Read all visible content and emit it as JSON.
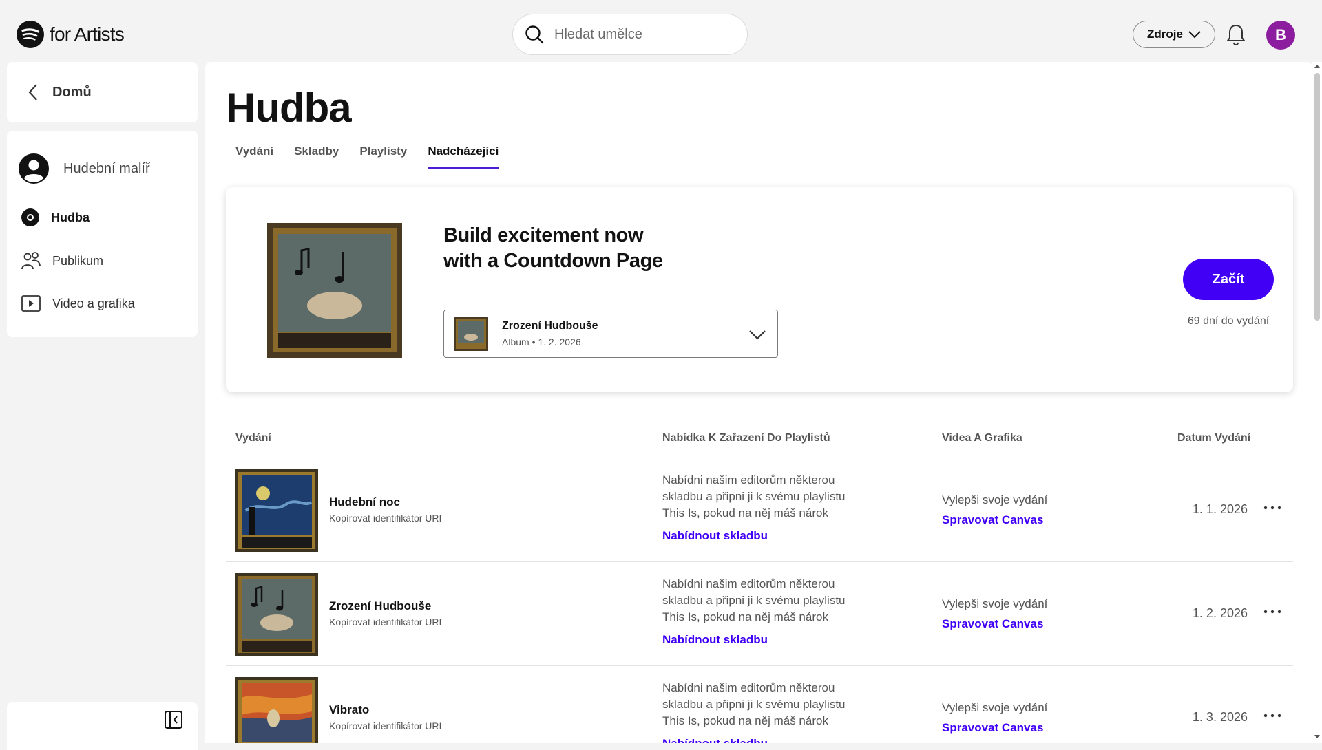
{
  "brand": {
    "text": "for Artists"
  },
  "search": {
    "placeholder": "Hledat umělce"
  },
  "header": {
    "resources_label": "Zdroje",
    "avatar_letter": "B"
  },
  "sidebar": {
    "home_label": "Domů",
    "artist_name": "Hudební malíř",
    "items": [
      {
        "label": "Hudba",
        "icon": "music-disc-icon",
        "active": true
      },
      {
        "label": "Publikum",
        "icon": "audience-icon",
        "active": false
      },
      {
        "label": "Video a grafika",
        "icon": "video-icon",
        "active": false
      }
    ]
  },
  "main": {
    "title": "Hudba",
    "tabs": [
      {
        "label": "Vydání",
        "active": false
      },
      {
        "label": "Skladby",
        "active": false
      },
      {
        "label": "Playlisty",
        "active": false
      },
      {
        "label": "Nadcházející",
        "active": true
      }
    ]
  },
  "promo": {
    "headline_line1": "Build excitement now",
    "headline_line2": "with a Countdown Page",
    "selected_release": {
      "title": "Zrození Hudbouše",
      "meta": "Album • 1. 2. 2026"
    },
    "start_label": "Začít",
    "days_left": "69 dní do vydání"
  },
  "table": {
    "headers": [
      "Vydání",
      "Nabídka K Zařazení Do Playlistů",
      "Videa A Grafika",
      "Datum Vydání"
    ],
    "rows": [
      {
        "title": "Hudební noc",
        "copy_uri": "Kopírovat identifikátor URI",
        "pitch_text": "Nabídni našim editorům některou skladbu a připni ji k svému playlistu This Is, pokud na něj máš nárok",
        "pitch_link": "Nabídnout skladbu",
        "vg_text": "Vylepši svoje vydání",
        "vg_link": "Spravovat Canvas",
        "date": "1. 1. 2026",
        "cover_caption": "Hudební noc"
      },
      {
        "title": "Zrození Hudbouše",
        "copy_uri": "Kopírovat identifikátor URI",
        "pitch_text": "Nabídni našim editorům některou skladbu a připni ji k svému playlistu This Is, pokud na něj máš nárok",
        "pitch_link": "Nabídnout skladbu",
        "vg_text": "Vylepši svoje vydání",
        "vg_link": "Spravovat Canvas",
        "date": "1. 2. 2026",
        "cover_caption": "Zrození hudbouše"
      },
      {
        "title": "Vibrato",
        "copy_uri": "Kopírovat identifikátor URI",
        "pitch_text": "Nabídni našim editorům některou skladbu a připni ji k svému playlistu This Is, pokud na něj máš nárok",
        "pitch_link": "Nabídnout skladbu",
        "vg_text": "Vylepši svoje vydání",
        "vg_link": "Spravovat Canvas",
        "date": "1. 3. 2026",
        "cover_caption": "Vibrato"
      }
    ]
  },
  "colors": {
    "accent": "#4100f5",
    "avatar": "#8c1d9f",
    "background": "#f3f3f3"
  }
}
